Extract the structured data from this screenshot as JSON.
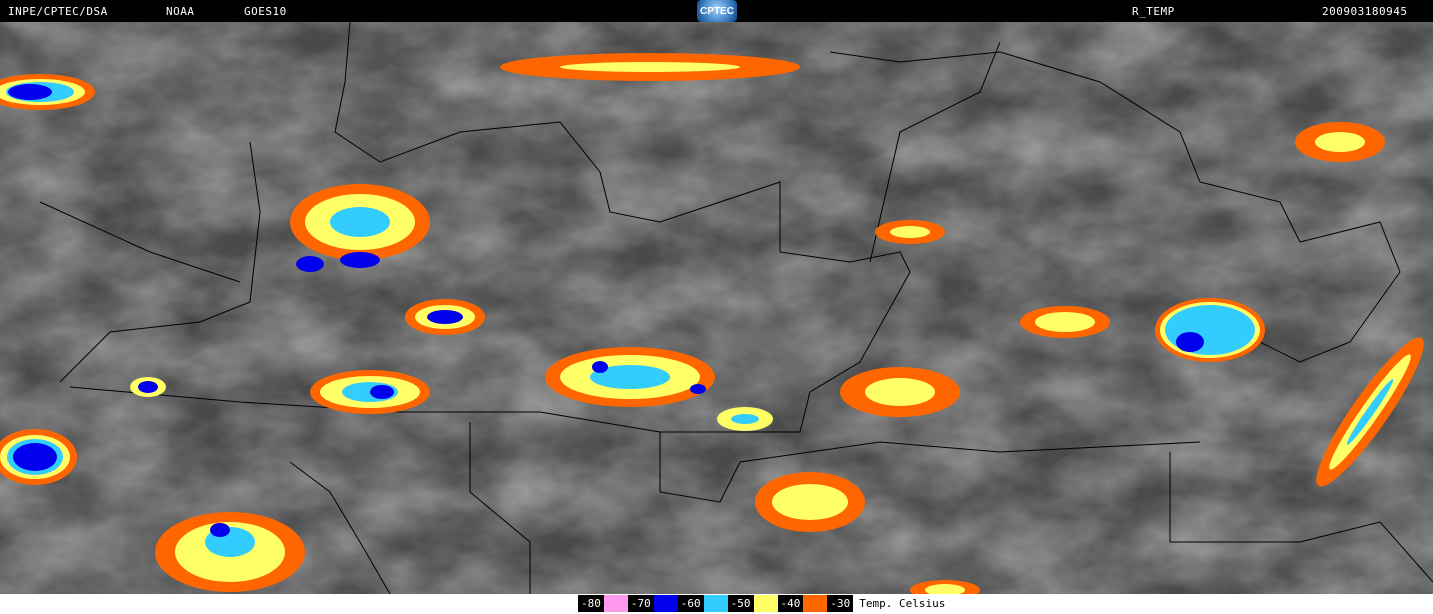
{
  "header": {
    "source": "INPE/CPTEC/DSA",
    "agency": "NOAA",
    "satellite": "GOES10",
    "logo_text": "CPTEC",
    "product": "R_TEMP",
    "timestamp": "200903180945"
  },
  "legend": {
    "unit_label": "Temp. Celsius",
    "entries": [
      {
        "label": "-80",
        "color": "#ff99ee"
      },
      {
        "label": "-70",
        "color": "#0000ee"
      },
      {
        "label": "-60",
        "color": "#33ccff"
      },
      {
        "label": "-50",
        "color": "#ffff66"
      },
      {
        "label": "-40",
        "color": "#ff6600"
      },
      {
        "label": "-30",
        "color": "#000000"
      }
    ]
  }
}
